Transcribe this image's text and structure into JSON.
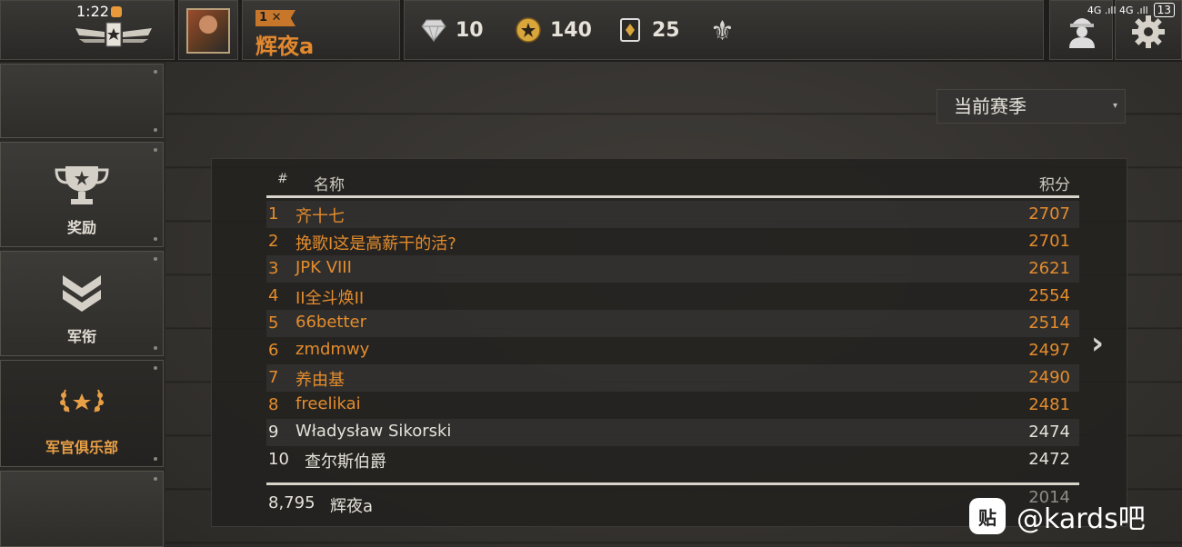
{
  "status_bar": {
    "time": "1:22",
    "network": "4G .ıll 4G .ıll",
    "battery": "13"
  },
  "player": {
    "rank": "1",
    "name": "辉夜a"
  },
  "resources": {
    "diamonds": "10",
    "gold": "140",
    "cards": "25"
  },
  "sidebar": {
    "items": [
      {
        "label": "奖励"
      },
      {
        "label": "军衔"
      },
      {
        "label": "军官俱乐部"
      }
    ]
  },
  "season_select": {
    "value": "当前赛季"
  },
  "leaderboard": {
    "columns": {
      "number": "#",
      "name": "名称",
      "score": "积分"
    },
    "rows": [
      {
        "rank": "1",
        "name": "齐十七",
        "score": "2707"
      },
      {
        "rank": "2",
        "name": "挽歌I这是高薪干的活?",
        "score": "2701"
      },
      {
        "rank": "3",
        "name": "JPK VIII",
        "score": "2621"
      },
      {
        "rank": "4",
        "name": "II全斗焕II",
        "score": "2554"
      },
      {
        "rank": "5",
        "name": "66better",
        "score": "2514"
      },
      {
        "rank": "6",
        "name": "zmdmwy",
        "score": "2497"
      },
      {
        "rank": "7",
        "name": "养由基",
        "score": "2490"
      },
      {
        "rank": "8",
        "name": "freelikai",
        "score": "2481"
      },
      {
        "rank": "9",
        "name": "Władysław Sikorski",
        "score": "2474"
      },
      {
        "rank": "10",
        "name": "查尔斯伯爵",
        "score": "2472"
      }
    ],
    "self": {
      "rank": "8,795",
      "name": "辉夜a",
      "score": "2014"
    }
  },
  "watermark": {
    "logo": "贴",
    "text": "@kards吧"
  },
  "colors": {
    "gold": "#e48c2d",
    "accent_badge": "#c8762a",
    "text": "#e5e1d9"
  }
}
